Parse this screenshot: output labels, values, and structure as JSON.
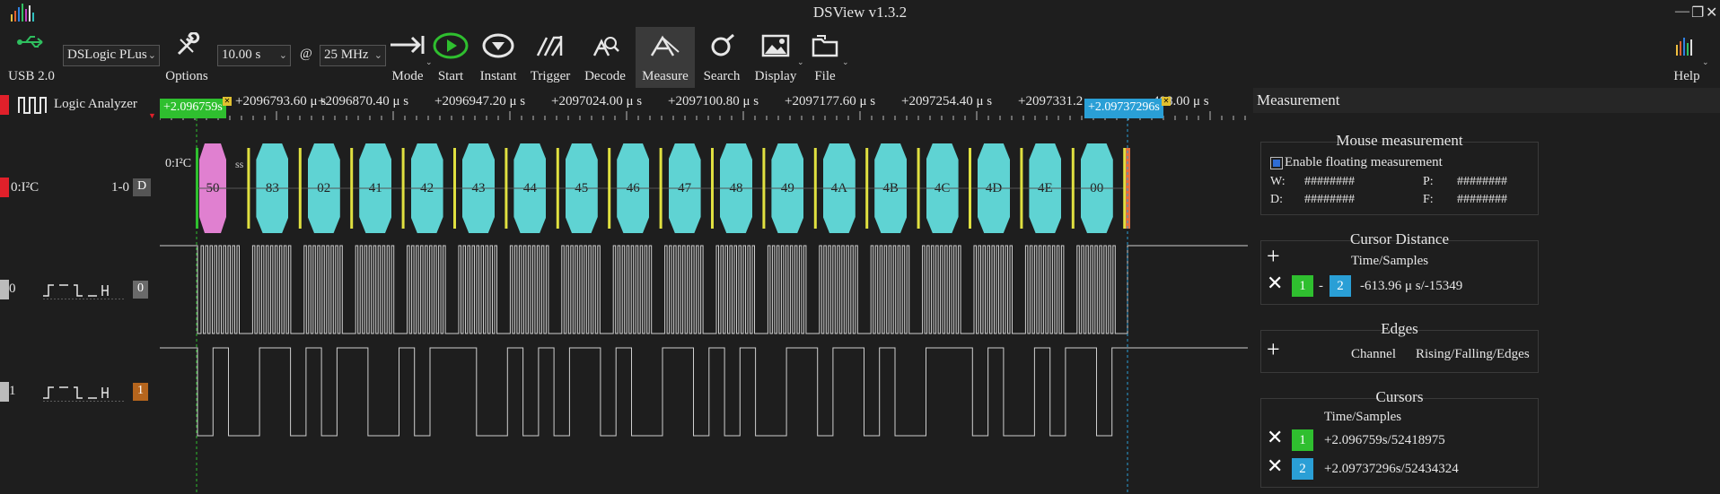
{
  "window": {
    "title": "DSView v1.3.2"
  },
  "toolbar": {
    "usb_label": "USB 2.0",
    "device": "DSLogic PLus",
    "options_label": "Options",
    "duration": "10.00 s",
    "at": "@",
    "rate": "25 MHz",
    "mode_label": "Mode",
    "start_label": "Start",
    "instant_label": "Instant",
    "trigger_label": "Trigger",
    "decode_label": "Decode",
    "measure_label": "Measure",
    "search_label": "Search",
    "display_label": "Display",
    "file_label": "File",
    "help_label": "Help"
  },
  "header": {
    "analyzer_label": "Logic Analyzer",
    "cursor1_time": "+2.096759s",
    "cursor2_time": "+2.09737296s",
    "ticks": [
      "+2096793.60 μ s",
      "+2096870.40 μ s",
      "+2096947.20 μ s",
      "+2097024.00 μ s",
      "+2097100.80 μ s",
      "+2097177.60 μ s",
      "+2097254.40 μ s",
      "+2097331.2",
      "408.00 μ s"
    ]
  },
  "decoder_row": {
    "name": "0:I²C",
    "range": "1-0",
    "badge": "D",
    "inline_label": "0:I²C",
    "addr_label": "ss",
    "bytes": [
      "50",
      "83",
      "02",
      "41",
      "42",
      "43",
      "44",
      "45",
      "46",
      "47",
      "48",
      "49",
      "4A",
      "4B",
      "4C",
      "4D",
      "4E",
      "00"
    ]
  },
  "channels": [
    {
      "index": "0",
      "badge": "0",
      "color": "#6a6a6a"
    },
    {
      "index": "1",
      "badge": "1",
      "color": "#b5651d"
    }
  ],
  "panel": {
    "title": "Measurement",
    "mouse": {
      "title": "Mouse measurement",
      "enable_label": "Enable floating measurement",
      "w_label": "W:",
      "w_value": "########",
      "p_label": "P:",
      "p_value": "########",
      "d_label": "D:",
      "d_value": "########",
      "f_label": "F:",
      "f_value": "########"
    },
    "cursor_distance": {
      "title": "Cursor Distance",
      "header": "Time/Samples",
      "from": "1",
      "dash": "-",
      "to": "2",
      "value": "-613.96 μ s/-15349"
    },
    "edges": {
      "title": "Edges",
      "col_channel": "Channel",
      "col_edges": "Rising/Falling/Edges"
    },
    "cursors": {
      "title": "Cursors",
      "header": "Time/Samples",
      "items": [
        {
          "num": "1",
          "value": "+2.096759s/52418975"
        },
        {
          "num": "2",
          "value": "+2.09737296s/52434324"
        }
      ]
    }
  },
  "colors": {
    "cursor1": "#2fbf2f",
    "cursor2": "#2a9fd6",
    "decode_cyan": "#5fd3d3",
    "decode_pink": "#e080d0",
    "marker_red": "#e0202a",
    "marker_gray": "#bbbbbb"
  }
}
